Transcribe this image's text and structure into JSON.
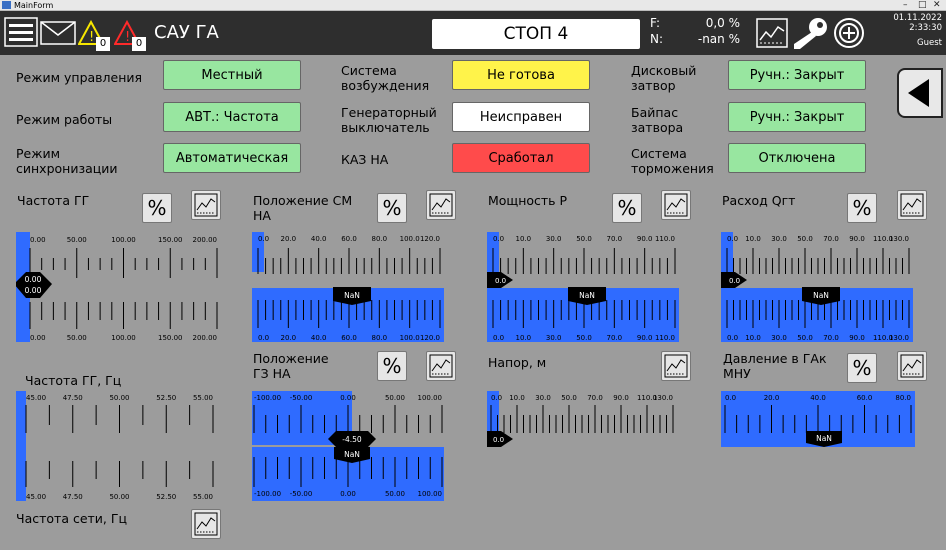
{
  "window": {
    "title": "MainForm"
  },
  "header": {
    "app_title": "САУ ГА",
    "warn_count_yellow": "0",
    "warn_count_red": "0",
    "status": "СТОП 4",
    "f_label": "F:",
    "f_value": "0,0 %",
    "n_label": "N:",
    "n_value": "-nan %",
    "date": "01.11.2022",
    "time": "2:33:30",
    "user": "Guest"
  },
  "status_rows": [
    {
      "label": "Режим управления",
      "value": "Местный",
      "color": "#98e6a0"
    },
    {
      "label": "Режим работы",
      "value": "АВТ.: Частота",
      "color": "#98e6a0"
    },
    {
      "label": "Режим синхронизации",
      "value": "Автоматическая",
      "color": "#98e6a0"
    },
    {
      "label": "Система возбуждения",
      "value": "Не готова",
      "color": "#fff34a"
    },
    {
      "label": "Генераторный выключатель",
      "value": "Неисправен",
      "color": "#ffffff"
    },
    {
      "label": "КАЗ НА",
      "value": "Сработал",
      "color": "#ff4b4b"
    },
    {
      "label": "Дисковый затвор",
      "value": "Ручн.: Закрыт",
      "color": "#98e6a0"
    },
    {
      "label": "Байпас затвора",
      "value": "Ручн.: Закрыт",
      "color": "#98e6a0"
    },
    {
      "label": "Система торможения",
      "value": "Отключена",
      "color": "#98e6a0"
    }
  ],
  "percent_label": "%",
  "gauges": {
    "freq_gg": {
      "title": "Частота ГГ",
      "ticks": [
        "0.00",
        "50.00",
        "100.00",
        "150.00",
        "200.00"
      ],
      "value_top": "0.00",
      "value_bottom": "0.00",
      "fraction": 0
    },
    "pos_sm": {
      "title": "Положение СМ НА",
      "ticks": [
        "0.0",
        "20.0",
        "40.0",
        "60.0",
        "80.0",
        "100.0",
        "120.0"
      ],
      "value_top": "",
      "value_bottom": "NaN",
      "fraction": 0
    },
    "power": {
      "title": "Мощность Р",
      "ticks": [
        "0.0",
        "10.0",
        "30.0",
        "50.0",
        "70.0",
        "90.0",
        "110.0"
      ],
      "value_top": "0.0",
      "value_bottom": "NaN",
      "fraction": 0
    },
    "flow": {
      "title": "Расход Qгт",
      "ticks": [
        "0.0",
        "10.0",
        "30.0",
        "50.0",
        "70.0",
        "90.0",
        "110.0",
        "130.0"
      ],
      "value_top": "0.0",
      "value_bottom": "NaN",
      "fraction": 0
    },
    "freq_gg_hz": {
      "title": "Частота ГГ, Гц",
      "ticks": [
        "45.00",
        "47.50",
        "50.00",
        "52.50",
        "55.00"
      ]
    },
    "pos_gz": {
      "title": "Положение ГЗ НА",
      "ticks": [
        "-100.00",
        "-50.00",
        "0.00",
        "50.00",
        "100.00"
      ],
      "value_top": "-4.50",
      "value_bottom": "NaN"
    },
    "head": {
      "title": "Напор, м",
      "ticks": [
        "0.0",
        "10.0",
        "30.0",
        "50.0",
        "70.0",
        "90.0",
        "110.0",
        "130.0"
      ],
      "value": "0.0"
    },
    "pressure": {
      "title": "Давление в ГАк МНУ",
      "ticks": [
        "0.0",
        "20.0",
        "40.0",
        "60.0",
        "80.0"
      ],
      "value": "NaN"
    },
    "grid_freq": {
      "title": "Частота сети, Гц"
    }
  },
  "colors": {
    "bar_blue": "#2f6bff",
    "panel": "#9c9c9c",
    "topbar": "#2e2e2e"
  }
}
